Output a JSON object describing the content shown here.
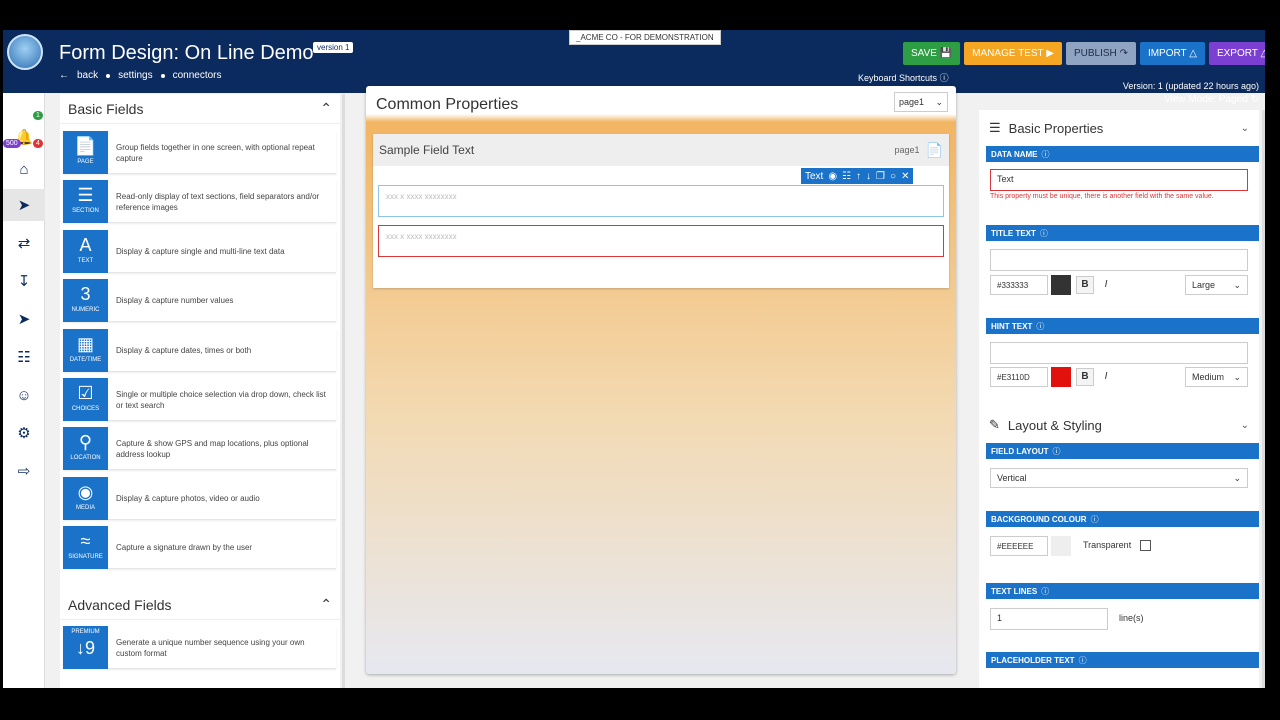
{
  "header": {
    "title": "Form Design: On Line Demo",
    "version_pill": "version 1",
    "demo_banner": "_ACME CO - FOR DEMONSTRATION",
    "nav": {
      "back": "back",
      "settings": "settings",
      "connectors": "connectors"
    },
    "keyboard_shortcuts": "Keyboard Shortcuts",
    "actions": {
      "save": "SAVE",
      "manage_test": "MANAGE TEST",
      "publish": "PUBLISH",
      "import": "IMPORT",
      "export": "EXPORT"
    },
    "version_info": "Version: 1 (updated 22 hours ago)",
    "view_mode": "View Mode: Paged"
  },
  "left_nav": {
    "badges": {
      "green": "1",
      "purple": "500",
      "red": "4"
    }
  },
  "basic_fields": {
    "title": "Basic Fields",
    "items": [
      {
        "label": "PAGE",
        "desc": "Group fields together in one screen, with optional repeat capture",
        "icon": "page-icon"
      },
      {
        "label": "SECTION",
        "desc": "Read-only display of text sections, field separators and/or reference images",
        "icon": "section-icon"
      },
      {
        "label": "TEXT",
        "desc": "Display & capture single and multi-line text data",
        "icon": "text-icon"
      },
      {
        "label": "NUMERIC",
        "desc": "Display & capture number values",
        "icon": "numeric-icon"
      },
      {
        "label": "DATE/TIME",
        "desc": "Display & capture dates, times or both",
        "icon": "calendar-icon"
      },
      {
        "label": "CHOICES",
        "desc": "Single or multiple choice selection via drop down, check list or text search",
        "icon": "checkbox-icon"
      },
      {
        "label": "LOCATION",
        "desc": "Capture & show GPS and map locations, plus optional address lookup",
        "icon": "location-pin-icon"
      },
      {
        "label": "MEDIA",
        "desc": "Display & capture photos, video or audio",
        "icon": "camera-icon"
      },
      {
        "label": "SIGNATURE",
        "desc": "Capture a signature drawn by the user",
        "icon": "signature-icon"
      }
    ]
  },
  "advanced_fields": {
    "title": "Advanced Fields",
    "items": [
      {
        "label": "PREMIUM",
        "desc": "Generate a unique number sequence using your own custom format",
        "icon": "number-sequence-icon"
      }
    ]
  },
  "canvas": {
    "title": "Common Properties",
    "page_select": "page1",
    "card_title": "Sample Field Text",
    "card_page": "page1",
    "toolbar_label": "Text",
    "placeholder_1": "xxx x xxxx xxxxxxxx",
    "placeholder_2": "xxx x xxxx xxxxxxxx"
  },
  "properties": {
    "basic_title": "Basic Properties",
    "data_name_label": "DATA NAME",
    "data_name_value": "Text",
    "data_name_error": "This property must be unique, there is another field with the same value.",
    "title_text_label": "TITLE TEXT",
    "title_color": "#333333",
    "title_size": "Large",
    "hint_text_label": "HINT TEXT",
    "hint_color": "#E3110D",
    "hint_size": "Medium",
    "bold": "B",
    "italic": "I",
    "layout_title": "Layout & Styling",
    "field_layout_label": "FIELD LAYOUT",
    "field_layout_value": "Vertical",
    "bg_colour_label": "BACKGROUND COLOUR",
    "bg_colour_value": "#EEEEEE",
    "transparent_label": "Transparent",
    "text_lines_label": "TEXT LINES",
    "text_lines_value": "1",
    "text_lines_unit": "line(s)",
    "placeholder_label": "PLACEHOLDER TEXT"
  },
  "colors": {
    "brand_navy": "#0b2a5e",
    "accent_blue": "#1a73c9",
    "error_red": "#d8383a"
  }
}
